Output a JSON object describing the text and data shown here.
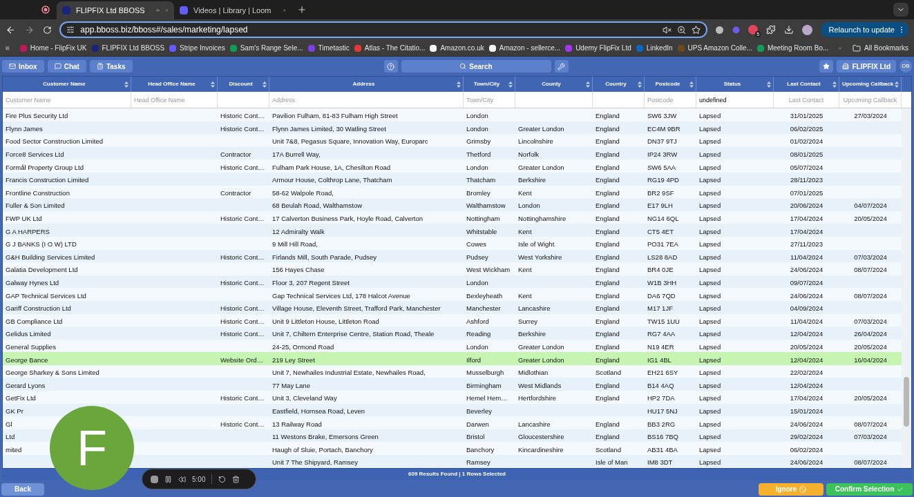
{
  "browser": {
    "tabs": [
      {
        "title": "FLIPFIX Ltd BBOSS",
        "selected": true
      },
      {
        "title": "Videos | Library | Loom",
        "selected": false
      }
    ],
    "url": "app.bboss.biz/bboss#/sales/marketing/lapsed",
    "extension_badge": "5",
    "relaunch": "Relaunch to update",
    "bookmarks": [
      {
        "label": "Home - FlipFix UK",
        "color": "#c2185b"
      },
      {
        "label": "FLIPFIX Ltd BBOSS",
        "color": "#1a237e"
      },
      {
        "label": "Stripe Invoices",
        "color": "#635bff"
      },
      {
        "label": "Sam's Range Sele...",
        "color": "#0f9d58"
      },
      {
        "label": "Timetastic",
        "color": "#7b3fe4"
      },
      {
        "label": "Atlas - The Citatio...",
        "color": "#e53935"
      },
      {
        "label": "Amazon.co.uk",
        "color": "#f5f5f5"
      },
      {
        "label": "Amazon - sellerce...",
        "color": "#f5f5f5"
      },
      {
        "label": "Udemy FlipFix Ltd",
        "color": "#a435f0"
      },
      {
        "label": "LinkedIn",
        "color": "#0a66c2"
      },
      {
        "label": "UPS Amazon Colle...",
        "color": "#6b4a1e"
      },
      {
        "label": "Meeting Room Bo...",
        "color": "#0f9d58"
      }
    ],
    "all_bookmarks": "All Bookmarks"
  },
  "toolbar": {
    "left": [
      "Inbox",
      "Chat",
      "Tasks"
    ],
    "search": "Search",
    "company": "FLIPFIX Ltd",
    "avatar": "DB"
  },
  "table": {
    "columns": [
      {
        "label": "Customer Name",
        "filter": {
          "placeholder": "Customer Name"
        }
      },
      {
        "label": "Head Office Name",
        "filter": {
          "placeholder": "Head Office Name"
        }
      },
      {
        "label": "Discount"
      },
      {
        "label": "Address",
        "filter": {
          "placeholder": "Address"
        }
      },
      {
        "label": "Town/City",
        "filter": {
          "placeholder": "Town/City"
        }
      },
      {
        "label": "County"
      },
      {
        "label": "Country"
      },
      {
        "label": "Postcode",
        "filter": {
          "placeholder": "Postcode"
        }
      },
      {
        "label": "Status",
        "filter": {
          "value": "undefined"
        }
      },
      {
        "label": "Last Contact",
        "filter": {
          "placeholder": "Last Contact"
        }
      },
      {
        "label": "Upcoming Callback",
        "filter": {
          "placeholder": "Upcoming Callback"
        }
      }
    ],
    "rows": [
      {
        "selected": false,
        "cells": [
          "Fire Plus Security Ltd",
          null,
          "Historic Cont…",
          "Pavilion Fulham, 81-83 Fulham High Street",
          "London",
          null,
          "England",
          "SW6 3JW",
          "Lapsed",
          "31/01/2025",
          "27/03/2024"
        ]
      },
      {
        "selected": false,
        "cells": [
          "Flynn James",
          null,
          "Historic Cont…",
          "Flynn James Limited, 30 Watling Street",
          "London",
          "Greater London",
          "England",
          "EC4M 9BR",
          "Lapsed",
          "06/02/2025",
          null
        ]
      },
      {
        "selected": false,
        "cells": [
          "Food Sector Construction Limited",
          null,
          null,
          "Unit 7&8, Pegasus Square, Innovation Way, Europarc",
          "Grimsby",
          "Lincolnshire",
          "England",
          "DN37 9TJ",
          "Lapsed",
          "01/02/2024",
          null
        ]
      },
      {
        "selected": false,
        "cells": [
          "Force8 Services Ltd",
          null,
          "Contractor",
          "17A Burrell Way,",
          "Thetford",
          "Norfolk",
          "England",
          "IP24 3RW",
          "Lapsed",
          "08/01/2025",
          null
        ]
      },
      {
        "selected": false,
        "cells": [
          "Formål Property Group Ltd",
          null,
          "Historic Cont…",
          "Fulham Park House, 1A, Chesilton Road",
          "London",
          "Greater London",
          "England",
          "SW6 5AA",
          "Lapsed",
          "05/07/2024",
          null
        ]
      },
      {
        "selected": false,
        "cells": [
          "Francis Construction Limited",
          null,
          null,
          "Armour House, Colthrop Lane, Thatcham",
          "Thatcham",
          "Berkshire",
          "England",
          "RG19 4PD",
          "Lapsed",
          "28/11/2023",
          null
        ]
      },
      {
        "selected": false,
        "cells": [
          "Frontline Construction",
          null,
          "Contractor",
          "58-62 Walpole Road,",
          "Bromley",
          "Kent",
          "England",
          "BR2 9SF",
          "Lapsed",
          "07/01/2025",
          null
        ]
      },
      {
        "selected": false,
        "cells": [
          "Fuller & Son Limited",
          null,
          null,
          "68 Beulah Road, Walthamstow",
          "Walthamstow",
          "London",
          "England",
          "E17 9LH",
          "Lapsed",
          "20/06/2024",
          "04/07/2024"
        ]
      },
      {
        "selected": false,
        "cells": [
          "FWP UK Ltd",
          null,
          "Historic Cont…",
          "17 Calverton Business Park, Hoyle Road, Calverton",
          "Nottingham",
          "Nottinghamshire",
          "England",
          "NG14 6QL",
          "Lapsed",
          "17/04/2024",
          "20/05/2024"
        ]
      },
      {
        "selected": false,
        "cells": [
          "G A HARPERS",
          null,
          null,
          "12 Admiralty Walk",
          "Whitstable",
          "Kent",
          "England",
          "CT5 4ET",
          "Lapsed",
          "17/04/2024",
          null
        ]
      },
      {
        "selected": false,
        "cells": [
          "G J BANKS (I O W) LTD",
          null,
          null,
          "9 Mill Hill Road,",
          "Cowes",
          "Isle of Wight",
          "England",
          "PO31 7EA",
          "Lapsed",
          "27/11/2023",
          null
        ]
      },
      {
        "selected": false,
        "cells": [
          "G&H Building Services Limited",
          null,
          "Historic Cont…",
          "Firlands Mill, South Parade, Pudsey",
          "Pudsey",
          "West Yorkshire",
          "England",
          "LS28 8AD",
          "Lapsed",
          "11/04/2024",
          "07/03/2024"
        ]
      },
      {
        "selected": false,
        "cells": [
          "Galatia Development Ltd",
          null,
          null,
          "156 Hayes Chase",
          "West Wickham",
          "Kent",
          "England",
          "BR4 0JE",
          "Lapsed",
          "24/06/2024",
          "08/07/2024"
        ]
      },
      {
        "selected": false,
        "cells": [
          "Galway Hynes Ltd",
          null,
          "Historic Cont…",
          "Floor 3, 207 Regent Street",
          "London",
          null,
          "England",
          "W1B 3HH",
          "Lapsed",
          "09/07/2024",
          null
        ]
      },
      {
        "selected": false,
        "cells": [
          "GAP Technical Services Ltd",
          null,
          null,
          "Gap Technical Services Ltd, 178 Halcot Avenue",
          "Bexleyheath",
          "Kent",
          "England",
          "DA6 7QD",
          "Lapsed",
          "24/06/2024",
          "08/07/2024"
        ]
      },
      {
        "selected": false,
        "cells": [
          "Gariff Construction Ltd",
          null,
          "Historic Cont…",
          "Village House, Eleventh Street, Trafford Park, Manchester",
          "Manchester",
          "Lancashire",
          "England",
          "M17 1JF",
          "Lapsed",
          "04/09/2024",
          null
        ]
      },
      {
        "selected": false,
        "cells": [
          "GB Compliance Ltd",
          null,
          "Historic Cont…",
          "Unit 9 Littleton House, Littleton Road",
          "Ashford",
          "Surrey",
          "England",
          "TW15 1UU",
          "Lapsed",
          "11/04/2024",
          "07/03/2024"
        ]
      },
      {
        "selected": false,
        "cells": [
          "Gelidus Limited",
          null,
          "Historic Cont…",
          "Unit 7, Chiltern Enterprise Centre, Station Road, Theale",
          "Reading",
          "Berkshire",
          "England",
          "RG7 4AA",
          "Lapsed",
          "12/04/2024",
          "26/04/2024"
        ]
      },
      {
        "selected": false,
        "cells": [
          "General Supplies",
          null,
          null,
          "24-25, Ormond Road",
          "London",
          "Greater London",
          "England",
          "N19 4ER",
          "Lapsed",
          "20/05/2024",
          "20/05/2024"
        ]
      },
      {
        "selected": true,
        "cells": [
          "George Bance",
          null,
          "Website Ord…",
          "219 Ley Street",
          "Ilford",
          "Greater London",
          "England",
          "IG1 4BL",
          "Lapsed",
          "12/04/2024",
          "16/04/2024"
        ]
      },
      {
        "selected": false,
        "cells": [
          "George Sharkey & Sons Limited",
          null,
          null,
          "Unit 7, Newhailes Industrial Estate, Newhailes Road,",
          "Musselburgh",
          "Midlothian",
          "Scotland",
          "EH21 6SY",
          "Lapsed",
          "22/02/2024",
          null
        ]
      },
      {
        "selected": false,
        "cells": [
          "Gerard Lyons",
          null,
          null,
          "77 May Lane",
          "Birmingham",
          "West Midlands",
          "England",
          "B14 4AQ",
          "Lapsed",
          "12/04/2024",
          null
        ]
      },
      {
        "selected": false,
        "cells": [
          "GetFix Ltd",
          null,
          "Historic Cont…",
          "Unit 3, Cleveland Way",
          "Hemel Hem…",
          "Hertfordshire",
          "England",
          "HP2 7DA",
          "Lapsed",
          "17/04/2024",
          "20/05/2024"
        ]
      },
      {
        "selected": false,
        "cells": [
          "GK Pr",
          null,
          null,
          "Eastfield, Hornsea Road, Leven",
          "Beverley",
          null,
          null,
          "HU17 5NJ",
          "Lapsed",
          "15/01/2024",
          null
        ]
      },
      {
        "selected": false,
        "cells": [
          "Gl",
          null,
          "Historic Cont…",
          "13 Railway Road",
          "Darwen",
          "Lancashire",
          "England",
          "BB3 2RG",
          "Lapsed",
          "24/06/2024",
          "08/07/2024"
        ]
      },
      {
        "selected": false,
        "cells": [
          "Ltd",
          null,
          null,
          "11 Westons Brake, Emersons Green",
          "Bristol",
          "Gloucestershire",
          "England",
          "BS16 7BQ",
          "Lapsed",
          "29/02/2024",
          "07/03/2024"
        ]
      },
      {
        "selected": false,
        "cells": [
          "mited",
          null,
          null,
          "Haugh of Sluie, Portach, Banchory",
          "Banchory",
          "Kincardineshire",
          "Scotland",
          "AB31 4BA",
          "Lapsed",
          "06/02/2024",
          null
        ]
      },
      {
        "selected": false,
        "cells": [
          null,
          null,
          null,
          "Unit 7 The Shipyard, Ramsey",
          "Ramsey",
          null,
          "Isle of Man",
          "IM8 3DT",
          "Lapsed",
          "24/06/2024",
          "08/07/2024"
        ]
      }
    ],
    "summary": "609 Results Found | 1 Rows Selected"
  },
  "footer": {
    "back": "Back",
    "ignore": "Ignore",
    "confirm": "Confirm Selection"
  },
  "recorder": {
    "time": "5:00",
    "bubble_letter": "F"
  }
}
